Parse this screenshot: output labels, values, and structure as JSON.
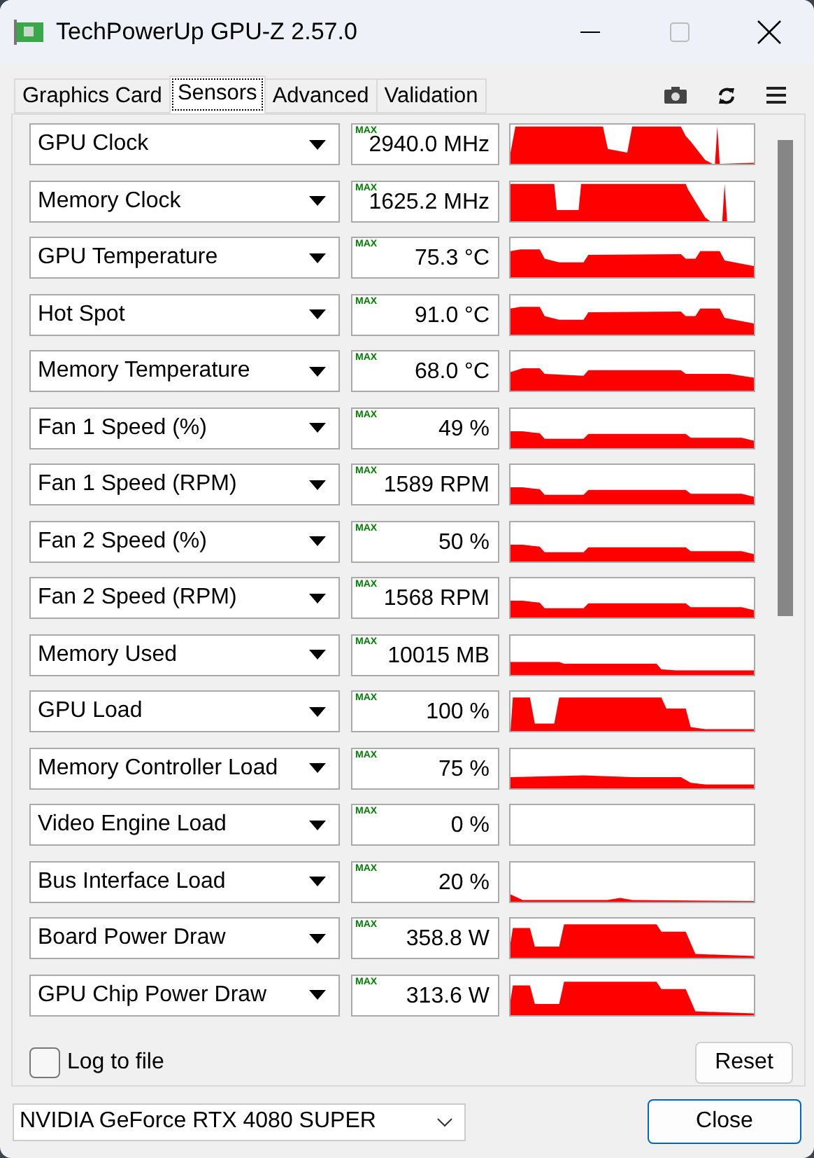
{
  "window": {
    "title": "TechPowerUp GPU-Z 2.57.0"
  },
  "tabs": [
    {
      "label": "Graphics Card",
      "selected": false
    },
    {
      "label": "Sensors",
      "selected": true
    },
    {
      "label": "Advanced",
      "selected": false
    },
    {
      "label": "Validation",
      "selected": false
    }
  ],
  "sensors": [
    {
      "name": "GPU Clock",
      "mode": "MAX",
      "value": "2940.0 MHz"
    },
    {
      "name": "Memory Clock",
      "mode": "MAX",
      "value": "1625.2 MHz"
    },
    {
      "name": "GPU Temperature",
      "mode": "MAX",
      "value": "75.3 °C"
    },
    {
      "name": "Hot Spot",
      "mode": "MAX",
      "value": "91.0 °C"
    },
    {
      "name": "Memory Temperature",
      "mode": "MAX",
      "value": "68.0 °C"
    },
    {
      "name": "Fan 1 Speed (%)",
      "mode": "MAX",
      "value": "49 %"
    },
    {
      "name": "Fan 1 Speed (RPM)",
      "mode": "MAX",
      "value": "1589 RPM"
    },
    {
      "name": "Fan 2 Speed (%)",
      "mode": "MAX",
      "value": "50 %"
    },
    {
      "name": "Fan 2 Speed (RPM)",
      "mode": "MAX",
      "value": "1568 RPM"
    },
    {
      "name": "Memory Used",
      "mode": "MAX",
      "value": "10015 MB"
    },
    {
      "name": "GPU Load",
      "mode": "MAX",
      "value": "100 %"
    },
    {
      "name": "Memory Controller Load",
      "mode": "MAX",
      "value": "75 %"
    },
    {
      "name": "Video Engine Load",
      "mode": "MAX",
      "value": "0 %"
    },
    {
      "name": "Bus Interface Load",
      "mode": "MAX",
      "value": "20 %"
    },
    {
      "name": "Board Power Draw",
      "mode": "MAX",
      "value": "358.8 W"
    },
    {
      "name": "GPU Chip Power Draw",
      "mode": "MAX",
      "value": "313.6 W"
    }
  ],
  "log_to_file": {
    "label": "Log to file",
    "checked": false
  },
  "reset_button": "Reset",
  "device_select": {
    "value": "NVIDIA GeForce RTX 4080 SUPER"
  },
  "close_button": "Close"
}
